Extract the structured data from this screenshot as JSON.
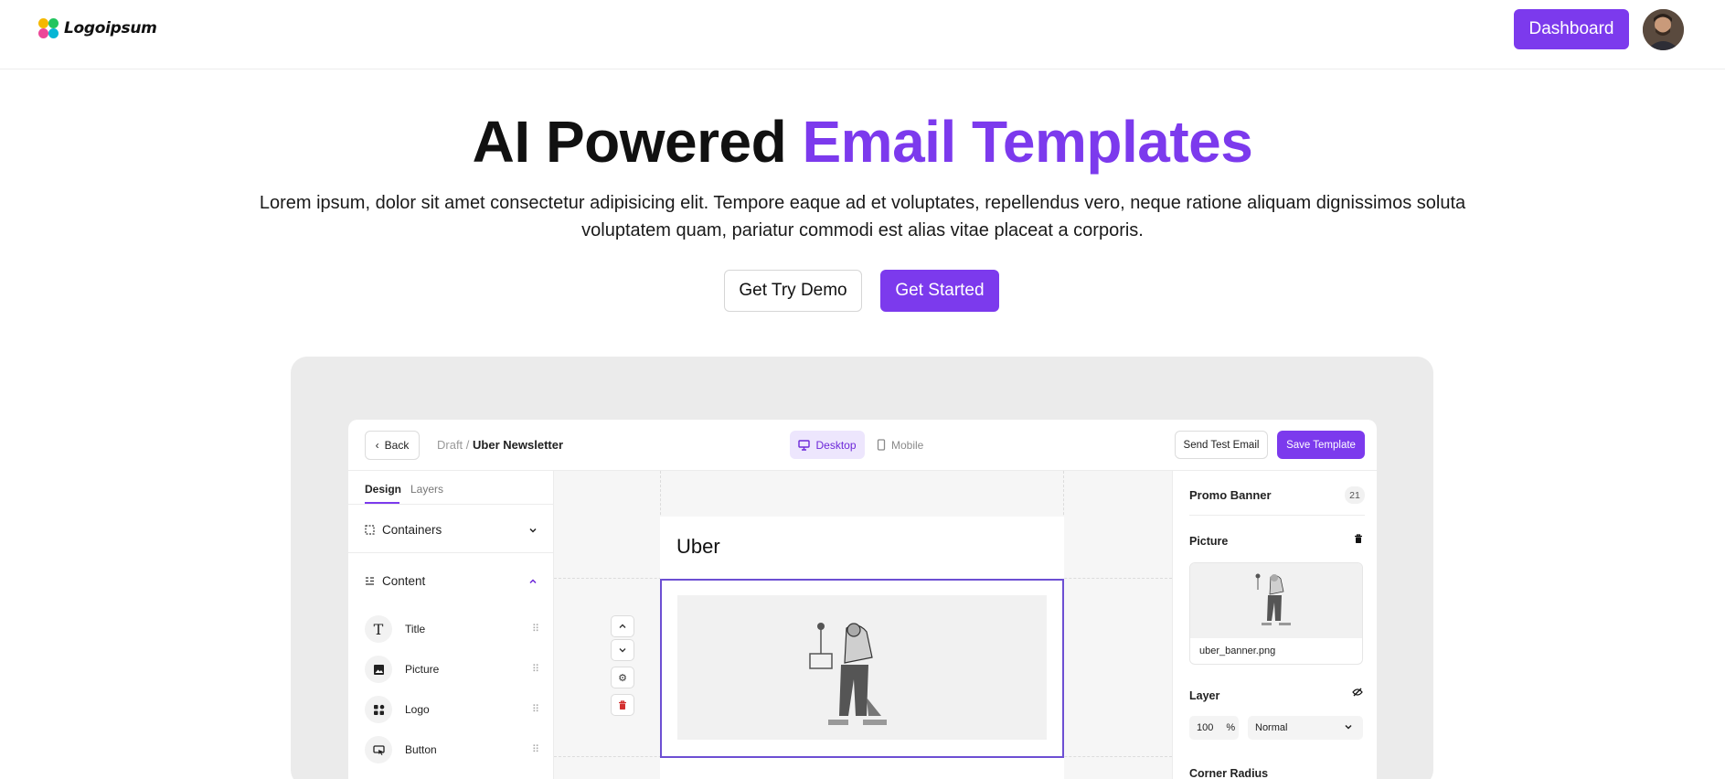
{
  "nav": {
    "logo_text": "Logoipsum",
    "dashboard_label": "Dashboard",
    "logo_colors": [
      "#f5b800",
      "#22c55e",
      "#ec4899",
      "#06b6d4"
    ]
  },
  "hero": {
    "title_main": "AI Powered",
    "title_accent": "Email Templates",
    "subtitle": "Lorem ipsum, dolor sit amet consectetur adipisicing elit. Tempore eaque ad et voluptates, repellendus vero, neque ratione aliquam dignissimos soluta voluptatem quam, pariatur commodi est alias vitae placeat a corporis.",
    "demo_label": "Get Try Demo",
    "start_label": "Get Started"
  },
  "editor": {
    "back_label": "Back",
    "crumb_draft": "Draft /",
    "crumb_name": "Uber Newsletter",
    "desktop_label": "Desktop",
    "mobile_label": "Mobile",
    "send_label": "Send Test Email",
    "save_label": "Save Template",
    "tabs": {
      "design": "Design",
      "layers": "Layers"
    },
    "sections": {
      "containers": "Containers",
      "content": "Content"
    },
    "items": [
      {
        "label": "Title",
        "icon": "title-icon"
      },
      {
        "label": "Picture",
        "icon": "picture-icon"
      },
      {
        "label": "Logo",
        "icon": "logo-grid-icon"
      },
      {
        "label": "Button",
        "icon": "button-cursor-icon"
      }
    ],
    "email_title": "Uber",
    "panel": {
      "title": "Promo Banner",
      "badge": "21",
      "picture_label": "Picture",
      "file_name": "uber_banner.png",
      "layer_label": "Layer",
      "opacity": "100",
      "opacity_unit": "%",
      "blend": "Normal",
      "corner_label": "Corner Radius"
    }
  },
  "colors": {
    "accent": "#7c3aed",
    "accent_soft": "#ede6fd",
    "selection": "#6d4fd3",
    "danger": "#d32f2f"
  }
}
